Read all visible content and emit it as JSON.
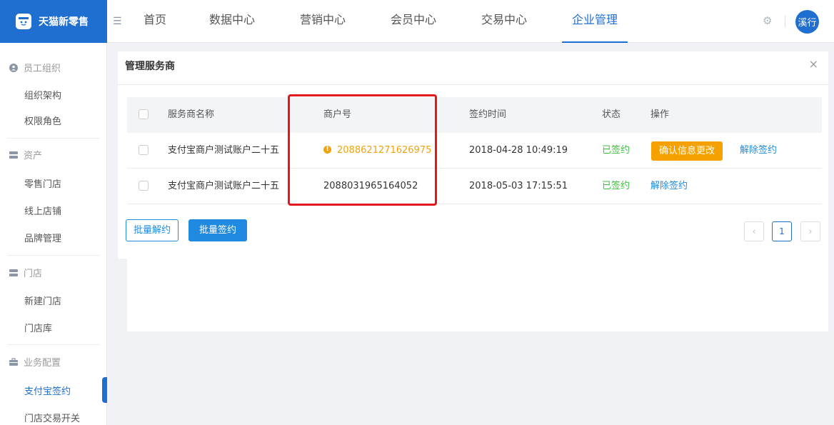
{
  "app": {
    "logo_text": "天猫新零售"
  },
  "nav": {
    "items": [
      "首页",
      "数据中心",
      "营销中心",
      "会员中心",
      "交易中心",
      "企业管理"
    ],
    "active": "企业管理"
  },
  "user": {
    "avatar_text": "溪行"
  },
  "sidebar": {
    "groups": [
      {
        "label": "员工组织",
        "items": [
          "组织架构",
          "权限角色"
        ]
      },
      {
        "label": "资产",
        "items": [
          "零售门店",
          "线上店铺",
          "品牌管理"
        ]
      },
      {
        "label": "门店",
        "items": [
          "新建门店",
          "门店库"
        ]
      },
      {
        "label": "业务配置",
        "items": [
          "支付宝签约",
          "门店交易开关"
        ]
      }
    ],
    "active_item": "支付宝签约"
  },
  "modal": {
    "title": "管理服务商",
    "close_glyph": "×",
    "table": {
      "columns": [
        "服务商名称",
        "商户号",
        "签约时间",
        "状态",
        "操作"
      ],
      "rows": [
        {
          "name": "支付宝商户测试账户二十五",
          "merchant_id": "2088621271626975",
          "warn_glyph": "!",
          "sign_time": "2018-04-28 10:49:19",
          "status": "已签约",
          "action_primary": "确认信息更改",
          "action_link": "解除签约"
        },
        {
          "name": "支付宝商户测试账户二十五",
          "merchant_id": "2088031965164052",
          "sign_time": "2018-05-03 17:15:51",
          "status": "已签约",
          "action_link": "解除签约"
        }
      ]
    },
    "batch_unsign": "批量解约",
    "batch_sign": "批量签约",
    "pagination": {
      "prev": "‹",
      "current": "1",
      "next": "›"
    }
  },
  "colors": {
    "brand": "#1f6fd1",
    "warning": "#f5a100",
    "success": "#3fbf3f",
    "link": "#1f8ae0",
    "highlight": "#e0191e"
  }
}
